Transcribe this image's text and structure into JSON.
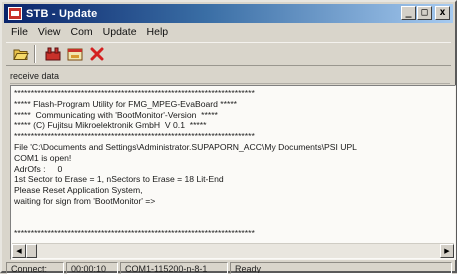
{
  "window": {
    "title": "STB - Update",
    "buttons": {
      "minimize": "_",
      "maximize": "□",
      "close": "x"
    }
  },
  "menu": [
    "File",
    "View",
    "Com",
    "Update",
    "Help"
  ],
  "toolbar": {
    "items": [
      {
        "name": "open-folder-icon",
        "color": "#c9a227"
      },
      {
        "name": "connect-icon",
        "color": "#c8312a"
      },
      {
        "name": "update-icon",
        "color": "#c8312a"
      },
      {
        "name": "cancel-icon",
        "color": "#d42020"
      }
    ]
  },
  "receive": {
    "label": "receive data",
    "lines": [
      "************************************************************************",
      "***** Flash-Program Utility for FMG_MPEG-EvaBoard *****",
      "*****  Communicating with 'BootMonitor'-Version  *****",
      "***** (C) Fujitsu Mikroelektronik GmbH  V 0.1  *****",
      "************************************************************************",
      "File 'C:\\Documents and Settings\\Administrator.SUPAPORN_ACC\\My Documents\\PSI UPL",
      "COM1 is open!",
      "AdrOfs :     0",
      "1st Sector to Erase = 1, nSectors to Erase = 18 Lit-End",
      "Please Reset Application System,",
      "waiting for sign from 'BootMonitor' =>",
      "",
      "",
      "************************************************************************"
    ]
  },
  "status": {
    "connection": "Connect:",
    "timer": "00:00:10",
    "port": "COM1-115200-n-8-1",
    "state": "Ready"
  }
}
